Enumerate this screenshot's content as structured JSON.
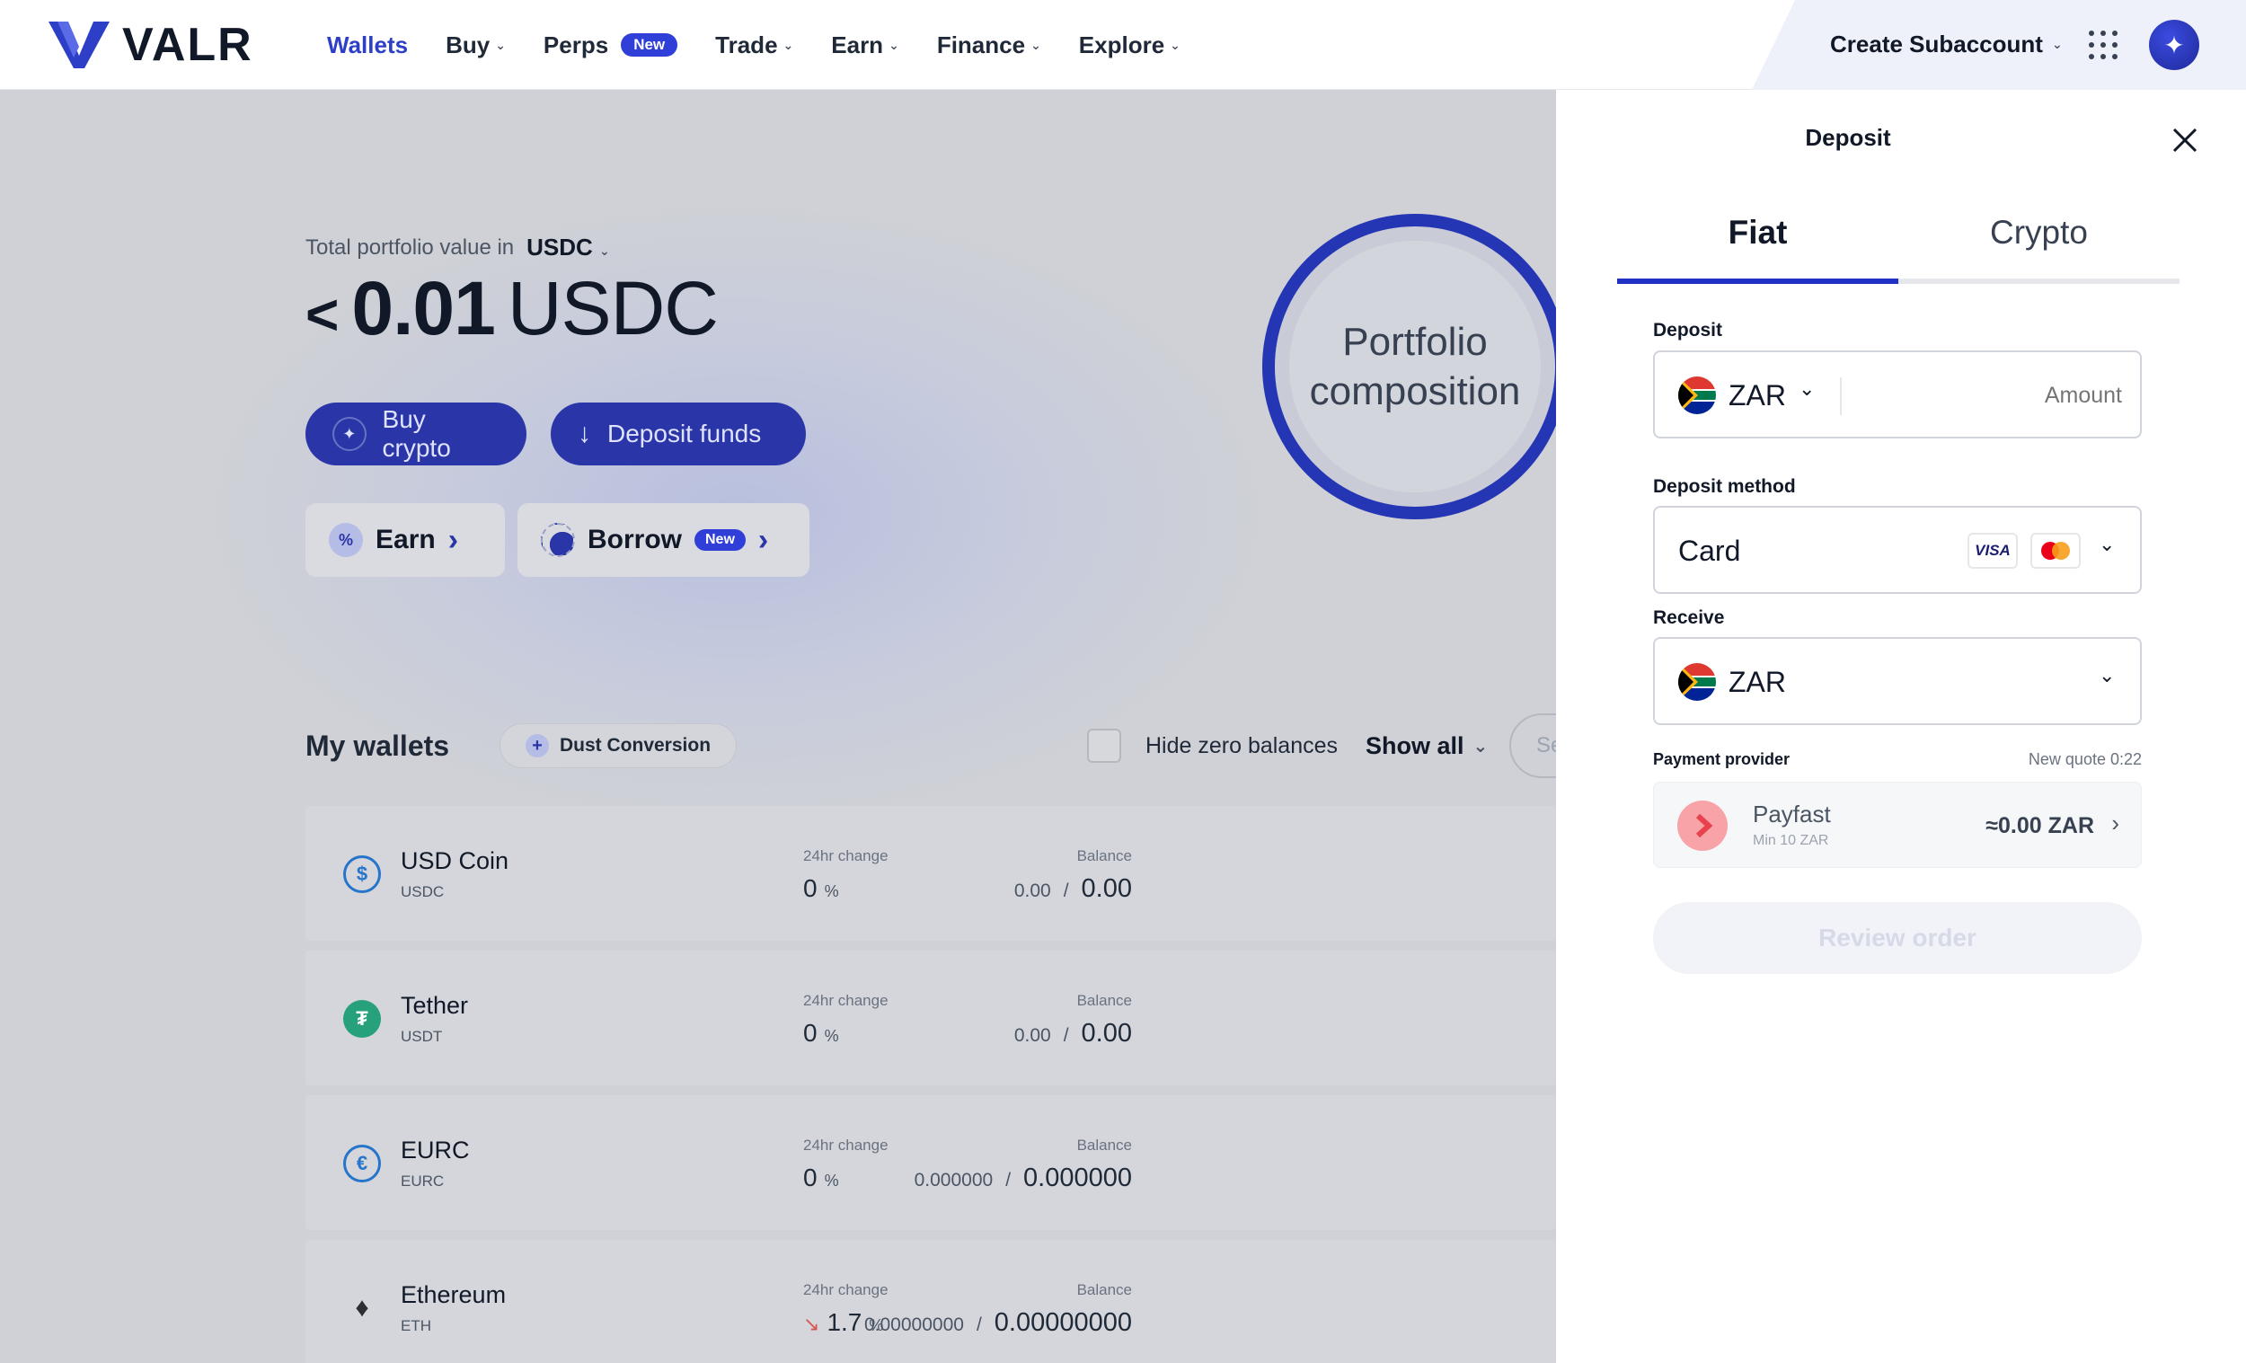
{
  "nav": {
    "logo_text": "VALR",
    "items": [
      {
        "label": "Wallets",
        "active": true
      },
      {
        "label": "Buy"
      },
      {
        "label": "Perps",
        "badge": "New"
      },
      {
        "label": "Trade"
      },
      {
        "label": "Earn"
      },
      {
        "label": "Finance"
      },
      {
        "label": "Explore"
      }
    ],
    "subaccount_label": "Create Subaccount",
    "icons": {
      "apps": "grid-dots-icon",
      "avatar": "sparkle-avatar-icon"
    }
  },
  "portfolio": {
    "label": "Total portfolio value in",
    "currency": "USDC",
    "prefix": "<",
    "value": "0.01",
    "value_currency": "USDC",
    "composition_label": "Portfolio composition"
  },
  "actions": {
    "buy_crypto": "Buy crypto",
    "deposit_funds": "Deposit funds",
    "earn": "Earn",
    "borrow": "Borrow",
    "borrow_badge": "New"
  },
  "wallets": {
    "title": "My wallets",
    "dust_conversion": "Dust Conversion",
    "hide_zero": "Hide zero balances",
    "show_all": "Show all",
    "search_placeholder": "Se",
    "change_label": "24hr change",
    "balance_label": "Balance",
    "rows": [
      {
        "name": "USD Coin",
        "symbol": "USDC",
        "change": "0",
        "change_unit": "%",
        "available": "0.00",
        "sep": "/",
        "total": "0.00",
        "icon": "usdc-icon",
        "color": "#2775ca"
      },
      {
        "name": "Tether",
        "symbol": "USDT",
        "change": "0",
        "change_unit": "%",
        "available": "0.00",
        "sep": "/",
        "total": "0.00",
        "icon": "tether-icon",
        "color": "#26a17b"
      },
      {
        "name": "EURC",
        "symbol": "EURC",
        "change": "0",
        "change_unit": "%",
        "available": "0.000000",
        "sep": "/",
        "total": "0.000000",
        "icon": "eurc-icon",
        "color": "#2775ca"
      },
      {
        "name": "Ethereum",
        "symbol": "ETH",
        "change": "1.7",
        "change_unit": "%",
        "available": "0.00000000",
        "sep": "/",
        "total": "0.00000000",
        "icon": "ethereum-icon",
        "color": "#3c3c3d",
        "trend": "down"
      }
    ]
  },
  "deposit_panel": {
    "title": "Deposit",
    "tabs": [
      "Fiat",
      "Crypto"
    ],
    "active_tab": "Fiat",
    "deposit_label": "Deposit",
    "deposit_currency": "ZAR",
    "amount_placeholder": "Amount",
    "method_label": "Deposit method",
    "method_value": "Card",
    "card_brands": [
      "VISA",
      "Mastercard"
    ],
    "receive_label": "Receive",
    "receive_currency": "ZAR",
    "provider_label": "Payment provider",
    "quote_label": "New quote 0:22",
    "provider_name": "Payfast",
    "provider_min": "Min 10 ZAR",
    "provider_amount": "≈0.00 ZAR",
    "review_label": "Review order"
  },
  "colors": {
    "brand": "#2d3fc7",
    "accent_dark": "#2a36a8",
    "tab_underline": "#2032c4",
    "overlay": "#cfd1d6",
    "payfast": "#f7a3a8"
  }
}
